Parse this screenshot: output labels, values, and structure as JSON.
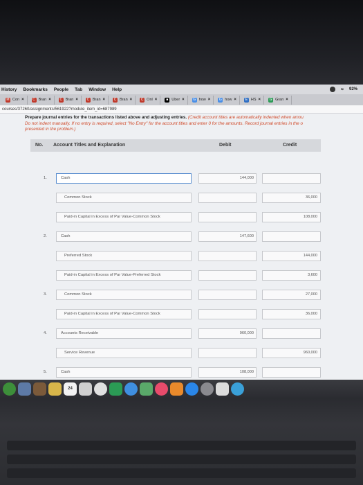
{
  "menubar": {
    "items": [
      "History",
      "Bookmarks",
      "People",
      "Tab",
      "Window",
      "Help"
    ],
    "battery": "92%"
  },
  "tabs": [
    {
      "label": "Con",
      "color": "#c0392b",
      "fav": "M"
    },
    {
      "label": "Bran",
      "color": "#c0392b",
      "fav": "C"
    },
    {
      "label": "Bran",
      "color": "#c0392b",
      "fav": "C"
    },
    {
      "label": "Bran",
      "color": "#c0392b",
      "fav": "C"
    },
    {
      "label": "Bran",
      "color": "#c0392b",
      "fav": "C"
    },
    {
      "label": "Onl",
      "color": "#c0392b",
      "fav": "C"
    },
    {
      "label": "Uber",
      "color": "#000000",
      "fav": "■"
    },
    {
      "label": "how",
      "color": "#4a8fe7",
      "fav": "G"
    },
    {
      "label": "how",
      "color": "#4a8fe7",
      "fav": "G"
    },
    {
      "label": "HS",
      "color": "#2f6fc4",
      "fav": "E"
    },
    {
      "label": "Gran",
      "color": "#2d9b57",
      "fav": "G"
    }
  ],
  "url": "courses/37260/assignments/561922?module_item_id=687989",
  "instructions": {
    "lead": "Prepare journal entries for the transactions listed above and adjusting entries.",
    "note1": "(Credit account titles are automatically indented when amou",
    "note2": "Do not indent manually. If no entry is required, select \"No Entry\" for the account titles and enter 0 for the amounts. Record journal entries in the o",
    "note3": "presented in the problem.)"
  },
  "table": {
    "col_no": "No.",
    "col_account": "Account Titles and Explanation",
    "col_debit": "Debit",
    "col_credit": "Credit",
    "rows": [
      {
        "no": "1.",
        "account": "Cash",
        "debit": "144,000",
        "credit": ""
      },
      {
        "no": "",
        "account": "Common Stock",
        "debit": "",
        "credit": "36,000"
      },
      {
        "no": "",
        "account": "Paid-in Capital in Excess of Par Value-Common Stock",
        "debit": "",
        "credit": "108,000"
      },
      {
        "no": "2.",
        "account": "Cash",
        "debit": "147,600",
        "credit": ""
      },
      {
        "no": "",
        "account": "Preferred Stock",
        "debit": "",
        "credit": "144,000"
      },
      {
        "no": "",
        "account": "Paid-in Capital in Excess of Par Value-Preferred Stock",
        "debit": "",
        "credit": "3,600"
      },
      {
        "no": "3.",
        "account": "Common Stock",
        "debit": "",
        "credit": "27,000"
      },
      {
        "no": "",
        "account": "Paid-in Capital in Excess of Par Value-Common Stock",
        "debit": "",
        "credit": "36,000"
      },
      {
        "no": "4.",
        "account": "Accounts Receivable",
        "debit": "960,000",
        "credit": ""
      },
      {
        "no": "",
        "account": "Service Revenue",
        "debit": "",
        "credit": "960,000"
      },
      {
        "no": "5.",
        "account": "Cash",
        "debit": "108,000",
        "credit": ""
      }
    ]
  },
  "dock": {
    "calendar_day": "24",
    "icons": [
      {
        "name": "chrome-icon",
        "color": "#3d8f3a",
        "round": true
      },
      {
        "name": "preview-icon",
        "color": "#5d7aa6",
        "round": false
      },
      {
        "name": "photos-box-icon",
        "color": "#7b5a3a",
        "round": false
      },
      {
        "name": "notes-icon",
        "color": "#d8b64a",
        "round": false
      },
      {
        "name": "calendar-icon",
        "color": "#f2f2f2",
        "round": false
      },
      {
        "name": "finder-icon",
        "color": "#cfcfcf",
        "round": false
      },
      {
        "name": "photos-icon",
        "color": "#e0e0e0",
        "round": true
      },
      {
        "name": "facetime-icon",
        "color": "#2b9b55",
        "round": false
      },
      {
        "name": "messages-icon",
        "color": "#3f8fe0",
        "round": true
      },
      {
        "name": "maps-icon",
        "color": "#5aa96a",
        "round": false
      },
      {
        "name": "itunes-icon",
        "color": "#e84b6b",
        "round": true
      },
      {
        "name": "books-icon",
        "color": "#e98a2b",
        "round": false
      },
      {
        "name": "appstore-icon",
        "color": "#2a86e8",
        "round": true
      },
      {
        "name": "settings-icon",
        "color": "#8a8a8f",
        "round": true
      },
      {
        "name": "photo-icon",
        "color": "#dcdcdc",
        "round": false
      },
      {
        "name": "app-icon",
        "color": "#3aa0d8",
        "round": true
      }
    ]
  }
}
